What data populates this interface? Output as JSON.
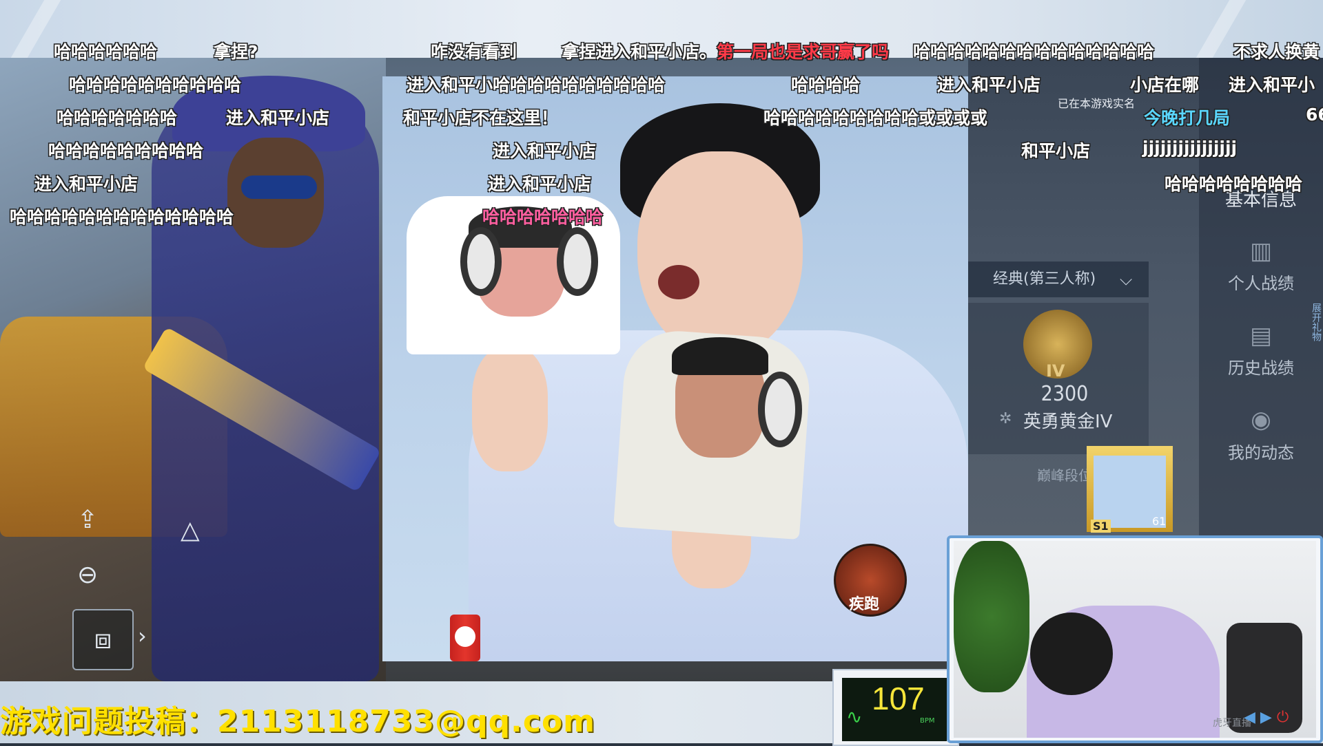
{
  "colors": {
    "danmaku_default": "#ffffff",
    "danmaku_red": "#ff3a48",
    "danmaku_pink": "#ff5fa0",
    "danmaku_cyan": "#5ad6ff",
    "contact_text": "#ffe000",
    "heart_rate_text": "#f7e63a",
    "webcam_border": "#6aa0d6"
  },
  "danmaku": {
    "row1": [
      "哈哈哈哈哈哈",
      "拿捏?",
      "咋没有看到",
      "拿捏进入和平小店。",
      "第一局也是求哥赢了吗",
      "哈哈哈哈哈哈哈哈哈哈哈哈哈哈",
      "不求人换黄"
    ],
    "row2": [
      "哈哈哈哈哈哈哈哈哈哈",
      "进入和平小哈哈哈哈哈哈哈哈哈哈",
      "哈哈哈哈",
      "进入和平小店",
      "小店在哪",
      "进入和平小"
    ],
    "row3": [
      "哈哈哈哈哈哈哈",
      "进入和平小店",
      "和平小店不在这里！",
      "哈哈哈哈哈哈哈哈哈或或或或",
      "今晚打几局",
      "66"
    ],
    "row4": [
      "哈哈哈哈哈哈哈哈哈",
      "进入和平小店",
      "和平小店",
      "jjjjjjjjjjjjjjjj"
    ],
    "row5": [
      "进入和平小店",
      "进入和平小店",
      "哈哈哈哈哈哈哈哈"
    ],
    "row6": [
      "哈哈哈哈哈哈哈哈哈哈哈哈哈",
      "哈哈哈哈哈哈哈"
    ]
  },
  "game_ui": {
    "verify_note": "已在本游戏实名",
    "basic_info": "基本信息",
    "personal_stats": "个人战绩",
    "history_stats": "历史战绩",
    "my_activity": "我的动态",
    "mode_selector": "经典(第三人称)",
    "rank_tier": "IV",
    "rank_score": "2300",
    "rank_name": "英勇黄金IV",
    "peak_label": "巅峰段位",
    "open_gift": "展开礼物",
    "sprint": "疾跑",
    "avatar_badge": "S1",
    "avatar_level": "61",
    "icons": {
      "share": "share-icon",
      "zoom_out": "zoom-out-icon",
      "triangle": "triangle-icon",
      "crate": "crate-icon",
      "arrow": "chevron-right-icon",
      "stats": "bar-chart-icon",
      "history": "document-icon",
      "activity": "person-icon",
      "chevron": "chevron-down-icon"
    }
  },
  "overlay": {
    "contact": "游戏问题投稿：2113118733@qq.com",
    "heart_rate": "107",
    "heart_rate_unit": "BPM",
    "webcam_watermark": "虎牙直播"
  }
}
